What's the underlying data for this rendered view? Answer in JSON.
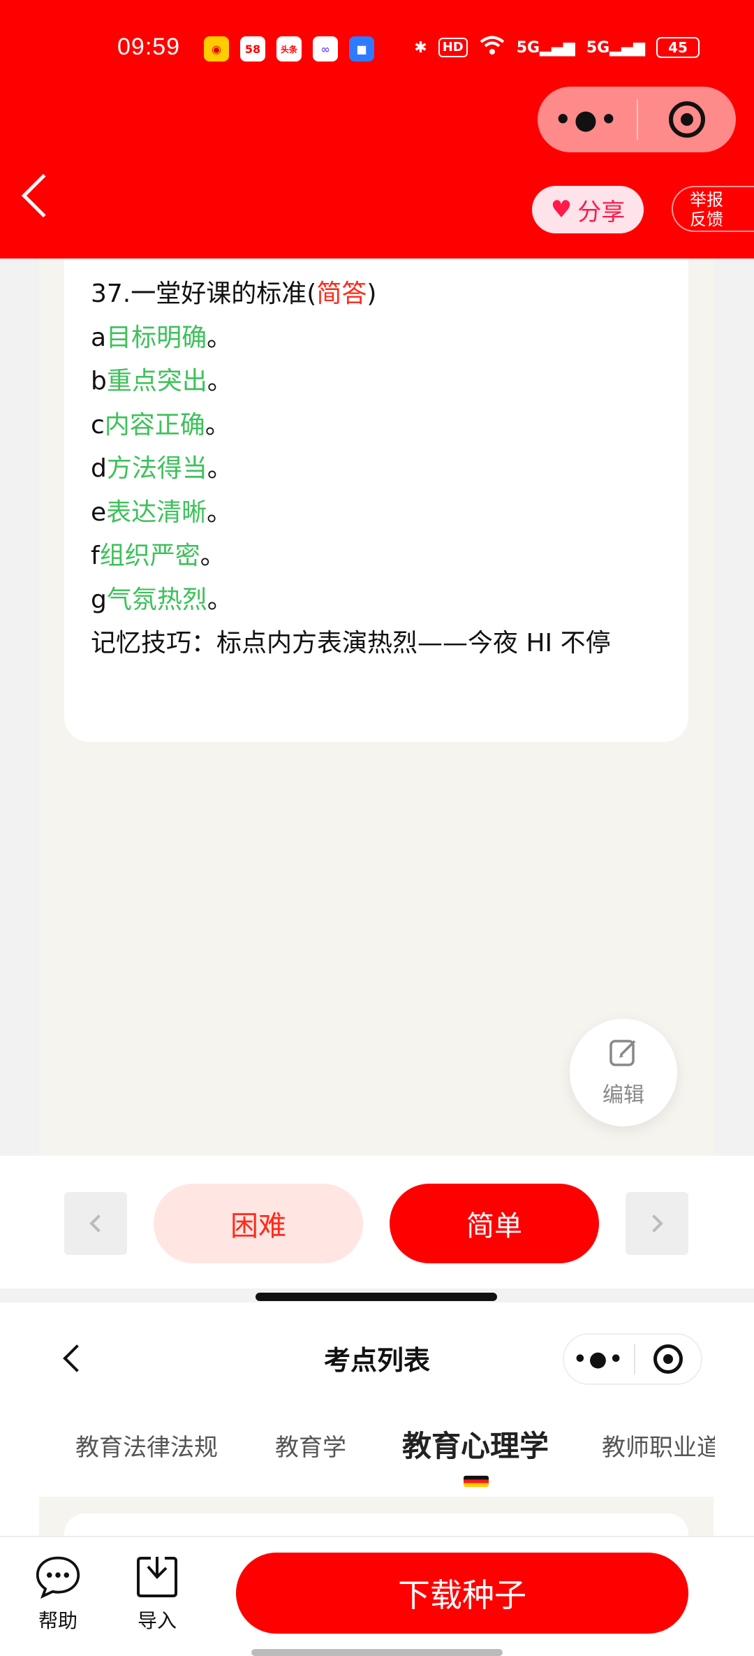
{
  "status_bar": {
    "time": "09:59",
    "app_icons": [
      {
        "name": "weibo-icon",
        "label": "◉"
      },
      {
        "name": "app-58-icon",
        "label": "58"
      },
      {
        "name": "toutiao-icon",
        "label": "头条"
      },
      {
        "name": "baidu-netdisk-icon",
        "label": "∞"
      },
      {
        "name": "app-blue-icon",
        "label": "■"
      }
    ],
    "hd_label": "HD",
    "signal1": "5G",
    "signal2": "5G",
    "battery": "45"
  },
  "header": {
    "share_label": "分享",
    "report_label_line1": "举报",
    "report_label_line2": "反馈"
  },
  "card": {
    "title_prefix": "37.一堂好课的标准(",
    "title_tag": "简答",
    "title_suffix": ")",
    "items": [
      {
        "letter": "a",
        "text": "目标明确",
        "end": "。"
      },
      {
        "letter": "b",
        "text": "重点突出",
        "end": "。"
      },
      {
        "letter": "c",
        "text": "内容正确",
        "end": "。"
      },
      {
        "letter": "d",
        "text": "方法得当",
        "end": "。"
      },
      {
        "letter": "e",
        "text": "表达清晰",
        "end": "。"
      },
      {
        "letter": "f",
        "text": "组织严密",
        "end": "。"
      },
      {
        "letter": "g",
        "text": "气氛热烈",
        "end": "。"
      }
    ],
    "memory_tip": "记忆技巧：标点内方表演热烈——今夜 HI 不停"
  },
  "edit_label": "编辑",
  "difficulty": {
    "hard_label": "困难",
    "easy_label": "简单"
  },
  "sheet": {
    "title": "考点列表",
    "tabs": [
      "教育法律法规",
      "教育学",
      "教育心理学",
      "教师职业道德"
    ],
    "active_tab": "教育心理学"
  },
  "actions": {
    "help_label": "帮助",
    "import_label": "导入",
    "download_label": "下载种子"
  },
  "colors": {
    "brand_red": "#ff0000",
    "answer_green": "#3dc15a",
    "tag_red": "#ff2a1a"
  }
}
